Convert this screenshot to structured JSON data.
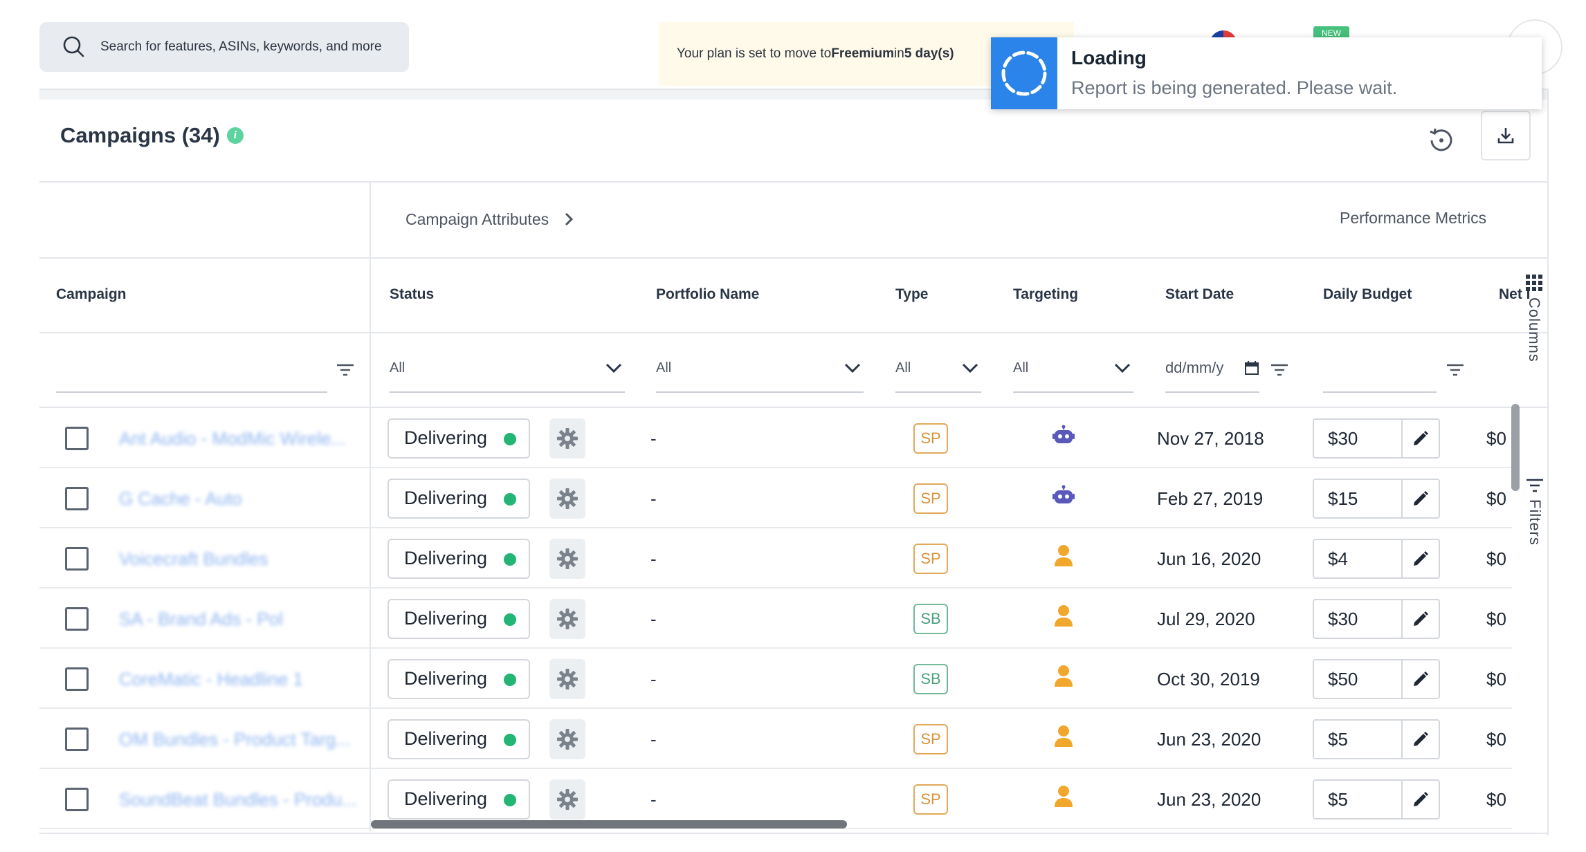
{
  "search": {
    "placeholder": "Search for features, ASINs, keywords, and more"
  },
  "plan_banner": {
    "prefix": "Your plan is set to move to ",
    "plan": "Freemium",
    "middle": " in ",
    "days": "5 day(s)"
  },
  "badge_new": "NEW",
  "toast": {
    "title": "Loading",
    "message": "Report is being generated. Please wait.",
    "accent": "#2a84e9"
  },
  "header": {
    "title": "Campaigns (34)",
    "info": "i"
  },
  "groups": {
    "attributes": "Campaign Attributes",
    "metrics": "Performance Metrics"
  },
  "columns": {
    "campaign": "Campaign",
    "status": "Status",
    "portfolio": "Portfolio Name",
    "type": "Type",
    "targeting": "Targeting",
    "start_date": "Start Date",
    "daily_budget": "Daily Budget",
    "net": "Net I"
  },
  "filters": {
    "status": "All",
    "portfolio": "All",
    "type": "All",
    "targeting": "All",
    "start_date": "dd/mm/y"
  },
  "side_tabs": {
    "columns": "Columns",
    "filters": "Filters"
  },
  "rows": [
    {
      "name": "Ant Audio - ModMic Wirele...",
      "status": "Delivering",
      "portfolio": "-",
      "type": "SP",
      "targeting": "robot-icon",
      "start_date": "Nov 27, 2018",
      "budget": "$30",
      "net": "$0"
    },
    {
      "name": "G Cache - Auto",
      "status": "Delivering",
      "portfolio": "-",
      "type": "SP",
      "targeting": "robot-icon",
      "start_date": "Feb 27, 2019",
      "budget": "$15",
      "net": "$0"
    },
    {
      "name": "Voicecraft Bundles",
      "status": "Delivering",
      "portfolio": "-",
      "type": "SP",
      "targeting": "person-icon",
      "start_date": "Jun 16, 2020",
      "budget": "$4",
      "net": "$0"
    },
    {
      "name": "SA - Brand Ads - Pol",
      "status": "Delivering",
      "portfolio": "-",
      "type": "SB",
      "targeting": "person-icon",
      "start_date": "Jul 29, 2020",
      "budget": "$30",
      "net": "$0"
    },
    {
      "name": "CoreMatic - Headline 1",
      "status": "Delivering",
      "portfolio": "-",
      "type": "SB",
      "targeting": "person-icon",
      "start_date": "Oct 30, 2019",
      "budget": "$50",
      "net": "$0"
    },
    {
      "name": "OM Bundles - Product Targ...",
      "status": "Delivering",
      "portfolio": "-",
      "type": "SP",
      "targeting": "person-icon",
      "start_date": "Jun 23, 2020",
      "budget": "$5",
      "net": "$0"
    },
    {
      "name": "SoundBeat Bundles - Produ...",
      "status": "Delivering",
      "portfolio": "-",
      "type": "SP",
      "targeting": "person-icon",
      "start_date": "Jun 23, 2020",
      "budget": "$5",
      "net": "$0"
    }
  ]
}
